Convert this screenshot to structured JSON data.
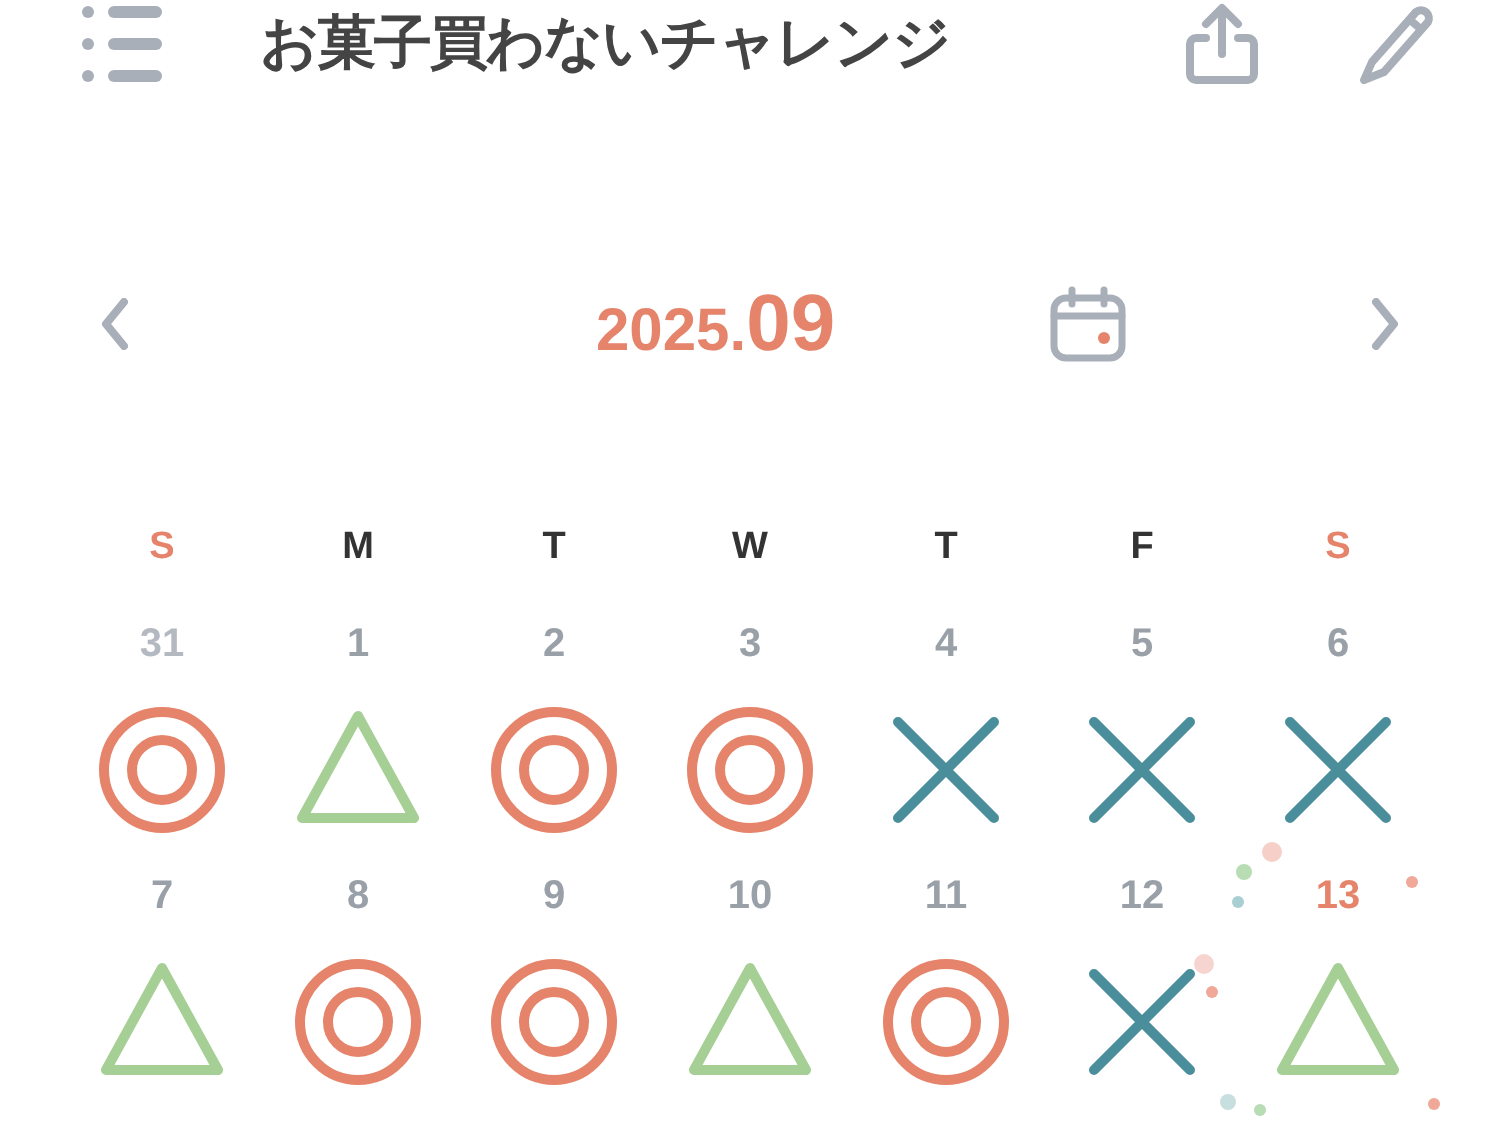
{
  "header": {
    "title": "お菓子買わないチャレンジ"
  },
  "month_nav": {
    "year": "2025.",
    "month": "09"
  },
  "weekdays": [
    {
      "label": "S",
      "weekend": true
    },
    {
      "label": "M",
      "weekend": false
    },
    {
      "label": "T",
      "weekend": false
    },
    {
      "label": "W",
      "weekend": false
    },
    {
      "label": "T",
      "weekend": false
    },
    {
      "label": "F",
      "weekend": false
    },
    {
      "label": "S",
      "weekend": true
    }
  ],
  "weeks": [
    [
      {
        "day": "31",
        "other_month": true,
        "today": false,
        "kind": "double-circle"
      },
      {
        "day": "1",
        "other_month": false,
        "today": false,
        "kind": "triangle"
      },
      {
        "day": "2",
        "other_month": false,
        "today": false,
        "kind": "double-circle"
      },
      {
        "day": "3",
        "other_month": false,
        "today": false,
        "kind": "double-circle"
      },
      {
        "day": "4",
        "other_month": false,
        "today": false,
        "kind": "cross"
      },
      {
        "day": "5",
        "other_month": false,
        "today": false,
        "kind": "cross"
      },
      {
        "day": "6",
        "other_month": false,
        "today": false,
        "kind": "cross"
      }
    ],
    [
      {
        "day": "7",
        "other_month": false,
        "today": false,
        "kind": "triangle"
      },
      {
        "day": "8",
        "other_month": false,
        "today": false,
        "kind": "double-circle"
      },
      {
        "day": "9",
        "other_month": false,
        "today": false,
        "kind": "double-circle"
      },
      {
        "day": "10",
        "other_month": false,
        "today": false,
        "kind": "triangle"
      },
      {
        "day": "11",
        "other_month": false,
        "today": false,
        "kind": "double-circle"
      },
      {
        "day": "12",
        "other_month": false,
        "today": false,
        "kind": "cross"
      },
      {
        "day": "13",
        "other_month": false,
        "today": true,
        "kind": "triangle"
      }
    ]
  ]
}
